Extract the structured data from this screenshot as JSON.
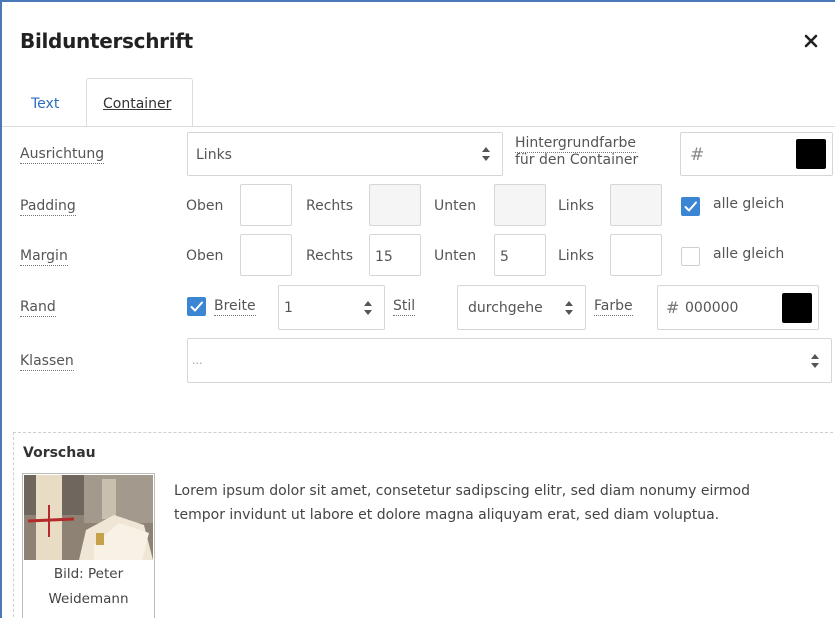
{
  "dialog": {
    "title": "Bildunterschrift"
  },
  "tabs": {
    "text": "Text",
    "container": "Container"
  },
  "ausrichtung": {
    "label": "Ausrichtung",
    "value": "Links"
  },
  "hintergrund": {
    "label_line1": "Hintergrundfarbe",
    "label_line2": "für den Container",
    "hash": "#",
    "value": ""
  },
  "padding": {
    "label": "Padding",
    "oben": "Oben",
    "rechts": "Rechts",
    "unten": "Unten",
    "links": "Links",
    "oben_value": "",
    "rechts_value": "",
    "unten_value": "",
    "links_value": "",
    "alle_gleich": "alle gleich",
    "alle_gleich_checked": true
  },
  "margin": {
    "label": "Margin",
    "oben": "Oben",
    "rechts": "Rechts",
    "unten": "Unten",
    "links": "Links",
    "oben_value": "",
    "rechts_value": "15",
    "unten_value": "5",
    "links_value": "",
    "alle_gleich": "alle gleich",
    "alle_gleich_checked": false
  },
  "rand": {
    "label": "Rand",
    "breite_label": "Breite",
    "breite_checked": true,
    "breite_value": "1",
    "stil_label": "Stil",
    "stil_value": "durchgehe",
    "farbe_label": "Farbe",
    "farbe_hash": "#",
    "farbe_value": "000000"
  },
  "klassen": {
    "label": "Klassen",
    "value": "..."
  },
  "vorschau": {
    "title": "Vorschau",
    "caption_line1": "Bild: Peter",
    "caption_line2": "Weidemann",
    "lorem_line1": "Lorem ipsum dolor sit amet, consetetur sadipscing elitr, sed diam nonumy eirmod",
    "lorem_line2": "tempor invidunt ut labore et dolore magna aliquyam erat, sed diam voluptua."
  },
  "colors": {
    "accent": "#3b86d4",
    "tab_link": "#2a6ebd",
    "border": "#4a78b8"
  }
}
